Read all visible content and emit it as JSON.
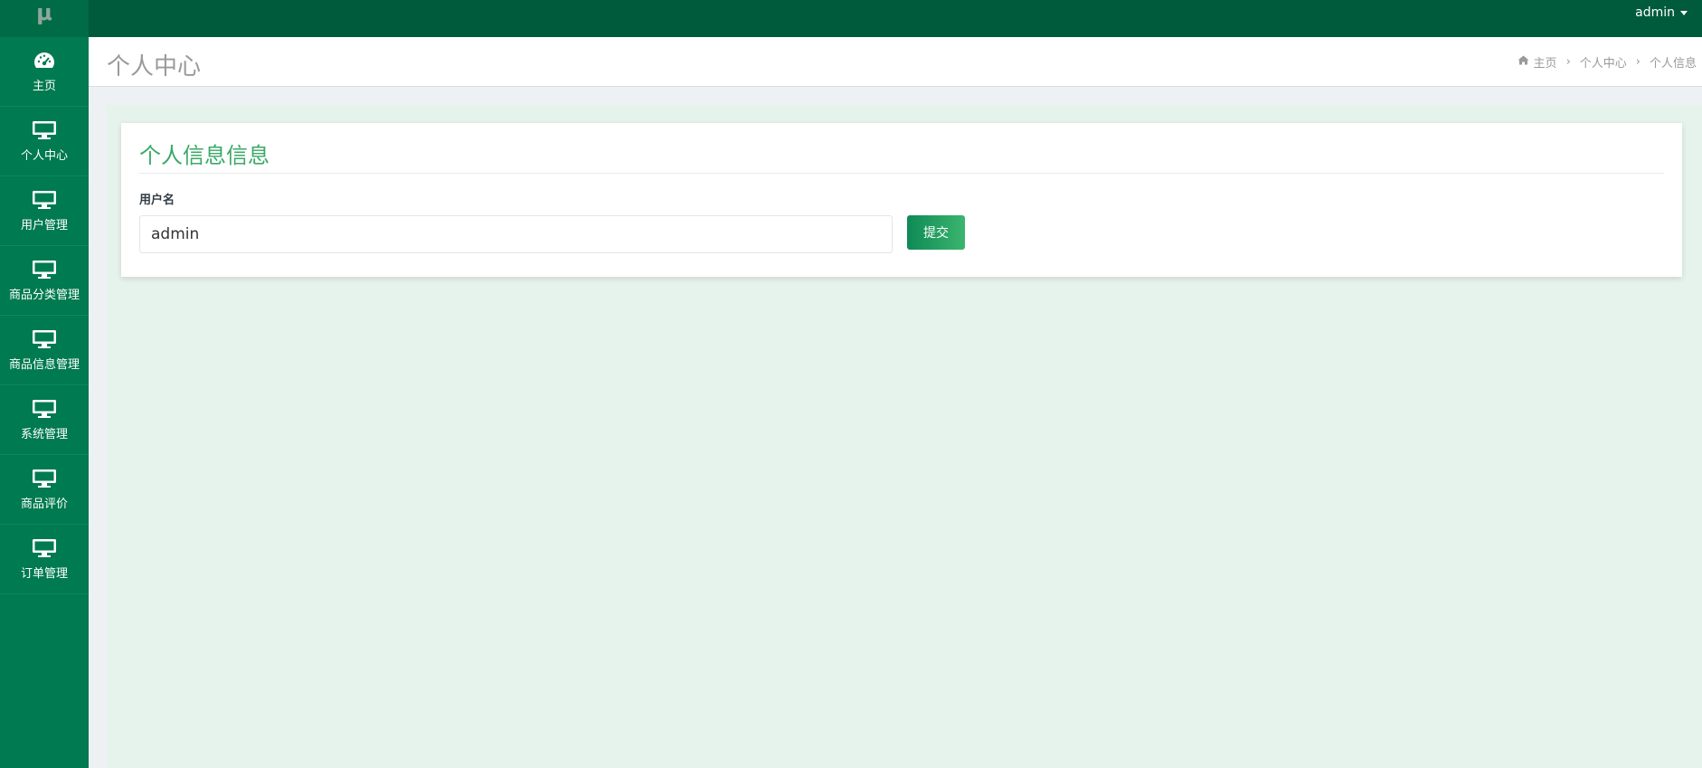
{
  "app": {
    "logo_text": "μ",
    "user_name": "admin"
  },
  "sidebar": {
    "items": [
      {
        "label": "主页",
        "icon": "dashboard-icon"
      },
      {
        "label": "个人中心",
        "icon": "monitor-icon"
      },
      {
        "label": "用户管理",
        "icon": "monitor-icon"
      },
      {
        "label": "商品分类管理",
        "icon": "monitor-icon"
      },
      {
        "label": "商品信息管理",
        "icon": "monitor-icon"
      },
      {
        "label": "系统管理",
        "icon": "monitor-icon"
      },
      {
        "label": "商品评价",
        "icon": "monitor-icon"
      },
      {
        "label": "订单管理",
        "icon": "monitor-icon"
      }
    ]
  },
  "header": {
    "title": "个人中心",
    "breadcrumb": [
      "主页",
      "个人中心",
      "个人信息"
    ]
  },
  "form": {
    "title": "个人信息信息",
    "username_label": "用户名",
    "username_value": "admin",
    "submit_label": "提交"
  },
  "colors": {
    "topbar": "#005a3c",
    "sidebar": "#007a50",
    "accent": "#3aa967",
    "content_bg": "#e6f2ec"
  }
}
